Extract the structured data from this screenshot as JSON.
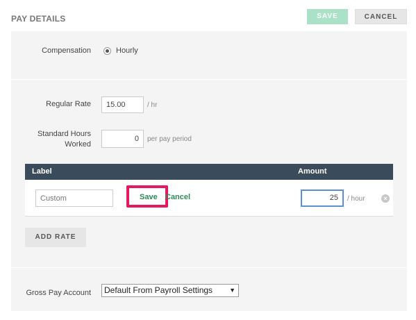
{
  "header": {
    "title": "PAY DETAILS",
    "save_label": "SAVE",
    "cancel_label": "CANCEL"
  },
  "compensation": {
    "label": "Compensation",
    "option_label": "Hourly"
  },
  "regular_rate": {
    "label": "Regular Rate",
    "value": "15.00",
    "unit": "/ hr"
  },
  "standard_hours": {
    "label_line1": "Standard Hours",
    "label_line2": "Worked",
    "value": "0",
    "unit": "per pay period"
  },
  "rate_table": {
    "columns": [
      "Label",
      "Amount"
    ],
    "row": {
      "label_placeholder": "Custom",
      "save_link": "Save",
      "cancel_link": "Cancel",
      "amount_value": "25",
      "amount_unit": "/ hour",
      "remove_icon": "close-circle-icon"
    }
  },
  "add_rate_label": "ADD RATE",
  "gross_pay": {
    "label": "Gross Pay Account",
    "selected": "Default From Payroll Settings"
  },
  "colors": {
    "accent_green": "#a9e2c7",
    "link_green": "#2e8b57",
    "table_header": "#3a4b5b",
    "highlight": "#e6195e"
  }
}
